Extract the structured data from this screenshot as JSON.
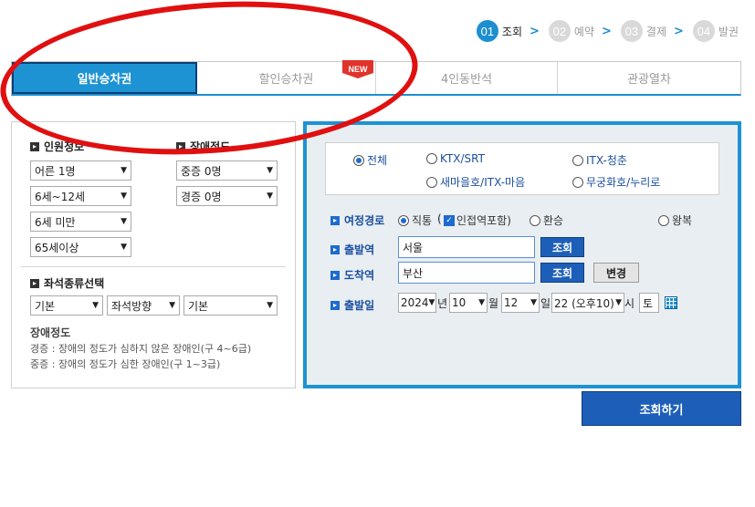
{
  "steps": [
    {
      "num": "01",
      "label": "조회",
      "active": true
    },
    {
      "num": "02",
      "label": "예약",
      "active": false
    },
    {
      "num": "03",
      "label": "결제",
      "active": false
    },
    {
      "num": "04",
      "label": "발권",
      "active": false
    }
  ],
  "step_arrow": ">",
  "tabs": [
    {
      "label": "일반승차권",
      "active": true
    },
    {
      "label": "할인승차권",
      "active": false,
      "badge": "NEW"
    },
    {
      "label": "4인동반석",
      "active": false
    },
    {
      "label": "관광열차",
      "active": false
    }
  ],
  "left": {
    "passenger_title": "인원정보",
    "disability_title": "장애정도",
    "passenger_selects": [
      "어른 1명",
      "6세~12세",
      "6세 미만",
      "65세이상"
    ],
    "disability_selects": [
      "중증 0명",
      "경증 0명"
    ],
    "seat_title": "좌석종류선택",
    "seat_selects": [
      "기본",
      "좌석방향",
      "기본"
    ],
    "note_title": "장애정도",
    "note_lines": [
      "경증 : 장애의 정도가 심하지 않은 장애인(구 4~6급)",
      "중증 : 장애의 정도가 심한 장애인(구 1~3급)"
    ]
  },
  "right": {
    "train_types": {
      "all": "전체",
      "ktx": "KTX/SRT",
      "itx_chungchun": "ITX-청춘",
      "saemaeul": "새마을호/ITX-마음",
      "mugunghwa": "무궁화호/누리로"
    },
    "route_label": "여정경로",
    "route_direct": "직통",
    "route_adjacent": "인접역포함)",
    "route_paren": "(",
    "route_transfer": "환승",
    "route_round": "왕복",
    "departure_label": "출발역",
    "departure_value": "서울",
    "arrival_label": "도착역",
    "arrival_value": "부산",
    "lookup_label": "조회",
    "change_label": "변경",
    "date_label": "출발일",
    "year": "2024",
    "year_unit": "년",
    "month": "10",
    "month_unit": "월",
    "day": "12",
    "day_unit": "일",
    "hour": "22 (오후10)",
    "hour_unit": "시",
    "weekday": "토"
  },
  "search_button": "조회하기",
  "colors": {
    "accent": "#1d93d3",
    "dark_tab_border": "#0b3f74",
    "button_blue": "#1d5fb8",
    "annotation_red": "#e01010",
    "new_badge": "#e0332b"
  }
}
